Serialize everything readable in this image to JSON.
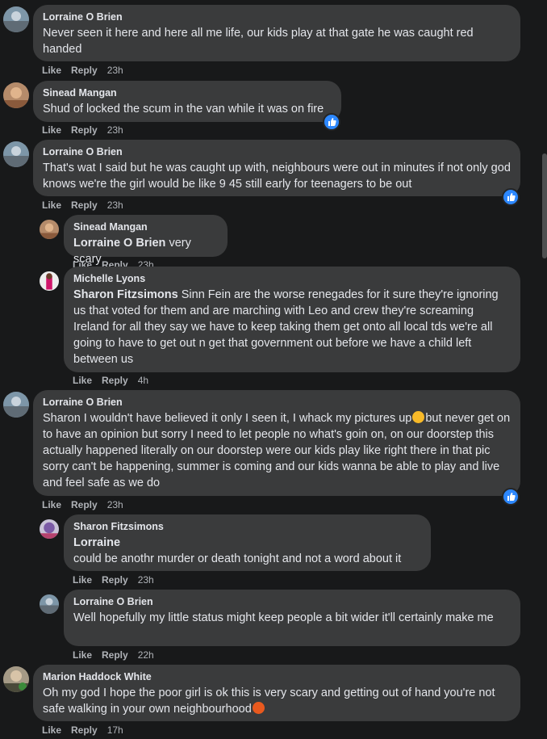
{
  "actions": {
    "like": "Like",
    "reply": "Reply"
  },
  "comments": [
    {
      "author": "Lorraine O Brien",
      "text": "Never seen it here and here all me life, our kids play at that gate he was caught red handed",
      "time": "23h"
    },
    {
      "author": "Sinead Mangan",
      "text": "Shud of locked the scum in the van while it was on fire",
      "time": "23h"
    },
    {
      "author": "Lorraine O Brien",
      "text": "That's wat I said but he was caught up with, neighbours were out in minutes if not only god knows we're the girl would be like 9 45 still early for teenagers to be out",
      "time": "23h"
    },
    {
      "author": "Sinead Mangan",
      "mention": "Lorraine O Brien",
      "text": "very scary",
      "time": "23h"
    },
    {
      "author": "Michelle Lyons",
      "mention": "Sharon Fitzsimons",
      "text": "Sinn Fein are the worse renegades for it sure they're ignoring us that voted for them and are marching with Leo and crew they're screaming Ireland for all they say we have to keep taking them get onto all local tds we're all going to have to get out n get that government out before we have a child left between us",
      "time": "4h"
    },
    {
      "author": "Lorraine O Brien",
      "text_part1": "Sharon I wouldn't have believed it only I seen it, I whack my pictures up",
      "text_part2": "but never get on to have an opinion but sorry I need to let people no what's goin on, on our doorstep this actually happened literally on our doorstep were our kids play like right there in that pic sorry can't be happening, summer is coming and our kids wanna be able to play and live and feel safe as we do",
      "time": "23h"
    },
    {
      "author": "Sharon Fitzsimons",
      "mention": "Lorraine",
      "text": "could be anothr murder or death tonight and not a word about it",
      "time": "23h"
    },
    {
      "author": "Lorraine O Brien",
      "text": "Well hopefully my little status might keep people a bit wider it'll certainly make me",
      "time": "22h"
    },
    {
      "author": "Marion Haddock White",
      "text": "Oh my god I hope the poor girl is ok this is very scary and getting out of hand you're not safe walking in your own neighbourhood",
      "time": "17h"
    }
  ],
  "colors": {
    "background": "#18191a",
    "bubble": "#3a3b3c",
    "like_blue": "#2d88ff"
  }
}
